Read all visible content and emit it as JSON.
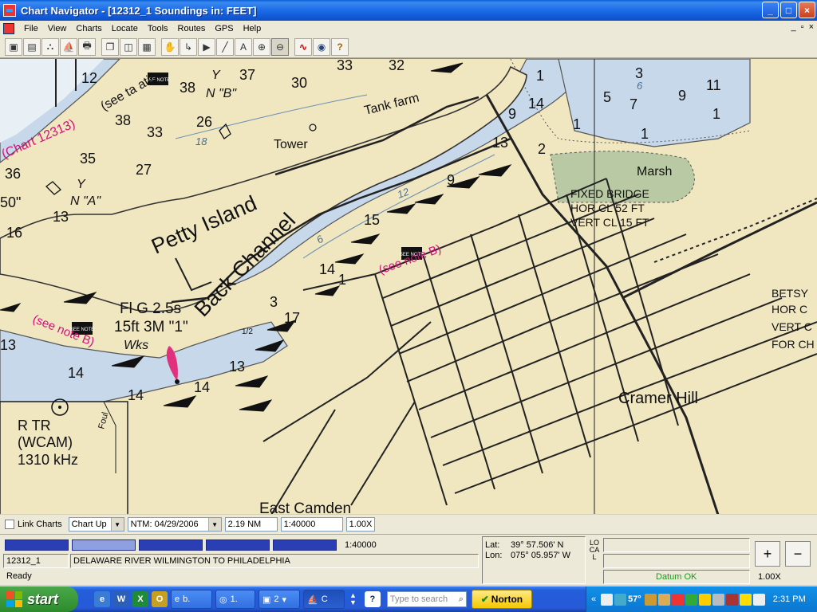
{
  "window": {
    "title": "Chart Navigator - [12312_1 Soundings in: FEET]",
    "buttons": {
      "minimize": "_",
      "maximize": "□",
      "close": "×"
    }
  },
  "menu": {
    "items": [
      "File",
      "View",
      "Charts",
      "Locate",
      "Tools",
      "Routes",
      "GPS",
      "Help"
    ],
    "mdi_controls": [
      "_",
      "▫",
      "×"
    ]
  },
  "toolbar": {
    "icons": [
      "open-chart-icon",
      "chart-list-icon",
      "tide-icon",
      "boat-icon",
      "print-icon",
      "copy-icon",
      "window-icon",
      "save-icon",
      "pan-hand-icon",
      "route-icon",
      "waypoint-icon",
      "line-icon",
      "text-icon",
      "zoom-in-icon",
      "zoom-out-icon",
      "signal-icon",
      "globe-icon",
      "help-icon"
    ],
    "glyphs": [
      "▣",
      "▤",
      "⛬",
      "⛵",
      "🖶",
      "❐",
      "◫",
      "▦",
      "✋",
      "↳",
      "▶",
      "╱",
      "A",
      "⊕",
      "⊖",
      "∿",
      "◉",
      "?"
    ]
  },
  "chart": {
    "labels": {
      "petty_island": "Petty  Island",
      "back_channel": "Back Channel",
      "tank_farm": "Tank farm",
      "tower": "Tower",
      "marsh": "Marsh",
      "fixed_bridge": [
        "FIXED BRIDGE",
        "HOR CL 52 FT",
        "VERT CL 15 FT"
      ],
      "betsy": [
        "BETSY",
        "HOR C",
        "VERT C",
        "FOR CH"
      ],
      "light": [
        "Fl G 2.5s",
        "15ft 3M \"1\""
      ],
      "wks": "Wks",
      "cramer_hill": "Cramer Hill",
      "east_camden": "East Camden",
      "radio_tower": [
        "R TR",
        "(WCAM)",
        "1310 kHz"
      ],
      "chart_12313": "(Chart 12313)",
      "see_note_1": "(see note B)",
      "see_note_2": "(see note B)",
      "see_table": "(see ta  atio",
      "buoy_a": "Y",
      "buoy_a_name": "N \"A\"",
      "buoy_b": "Y",
      "buoy_b_name": "N \"B\"",
      "see_note_icon": "SEE NOTE",
      "half": "1/2",
      "foul": "Foul"
    },
    "soundings": [
      "12",
      "38",
      "37",
      "30",
      "33",
      "32",
      "38",
      "33",
      "26",
      "35",
      "27",
      "36",
      "13",
      "16",
      "50\"",
      "14",
      "14",
      "13",
      "14",
      "13",
      "17",
      "3",
      "14",
      "1",
      "15",
      "9",
      "13",
      "12",
      "6",
      "18",
      "9",
      "14",
      "1",
      "2",
      "1",
      "5",
      "7",
      "9",
      "11",
      "3",
      "6",
      "1",
      "1"
    ]
  },
  "status_row": {
    "link_charts": "Link Charts",
    "chart_up": "Chart Up",
    "ntm": "NTM: 04/29/2006",
    "distance": "2.19 NM",
    "scale": "1:40000",
    "zoom": "1.00X"
  },
  "panel": {
    "scale_label": "1:40000",
    "chart_id": "12312_1",
    "chart_name": "DELAWARE RIVER WILMINGTON TO PHILADELPHIA",
    "ready": "Ready",
    "lat_label": "Lat:",
    "lat_value": "39° 57.506' N",
    "lon_label": "Lon:",
    "lon_value": "075° 05.957' W",
    "local": "LOCAL",
    "datum": "Datum OK",
    "zoom_in": "+",
    "zoom_out": "−",
    "zoom_value": "1.00X"
  },
  "taskbar": {
    "start": "start",
    "buttons": [
      "b.",
      "1.",
      "2",
      "C"
    ],
    "search_placeholder": "Type to search",
    "norton": "Norton",
    "temp": "57°",
    "clock": "2:31 PM"
  },
  "colors": {
    "land": "#f0e6c0",
    "shallow": "#c6d8ea",
    "deep": "#ffffff",
    "magenta": "#d0107a",
    "titlebar": "#0a5fd8"
  }
}
